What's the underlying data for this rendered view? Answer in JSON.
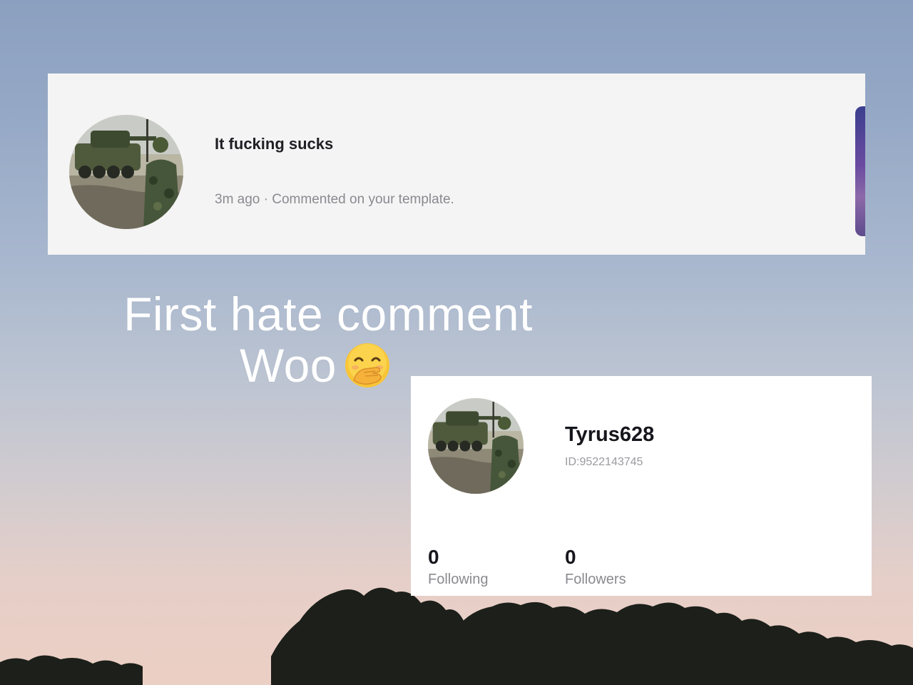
{
  "notification": {
    "comment_text": "It fucking sucks",
    "meta_text": "3m ago · Commented on your template.",
    "avatar_icon": "soldier-with-armored-vehicle-photo"
  },
  "caption": {
    "line1": "First hate comment",
    "line2": "Woo",
    "emoji": "face-with-hand-over-mouth"
  },
  "profile": {
    "username": "Tyrus628",
    "user_id": "ID:9522143745",
    "following_count": "0",
    "following_label": "Following",
    "followers_count": "0",
    "followers_label": "Followers"
  },
  "colors": {
    "sky_top": "#8b9fc0",
    "sky_bottom": "#eccfc4",
    "card_bg": "#f4f4f4",
    "profile_bg": "#ffffff",
    "text_dark": "#1f1f24",
    "text_muted": "#8a8a90"
  }
}
